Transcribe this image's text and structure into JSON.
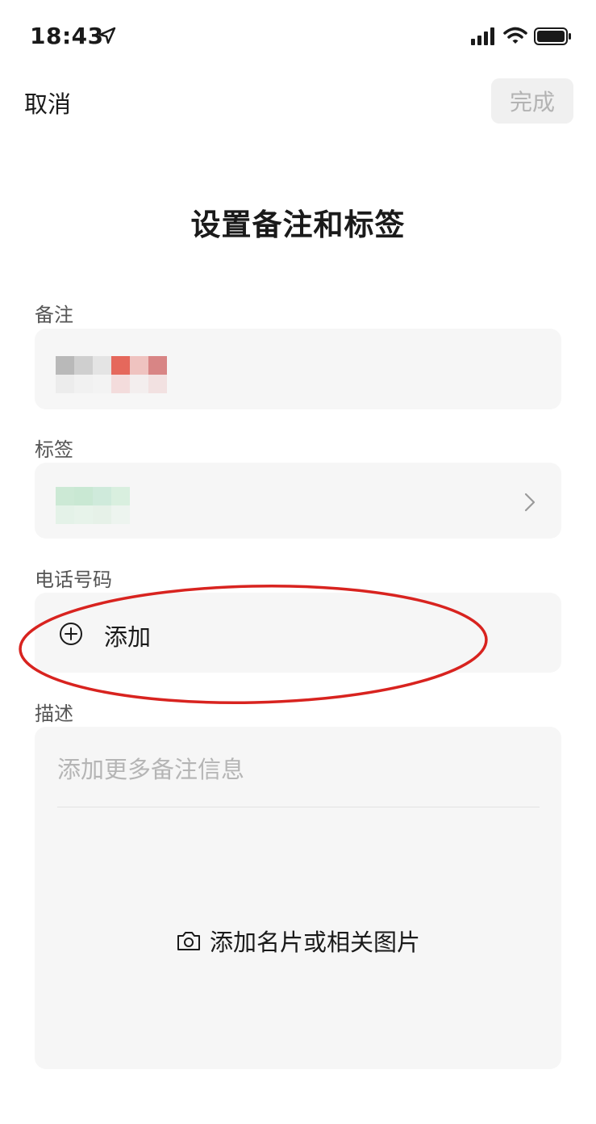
{
  "status_bar": {
    "time": "18:43",
    "icons": [
      "location-arrow-icon",
      "signal-icon",
      "wifi-icon",
      "battery-icon"
    ]
  },
  "nav": {
    "cancel_label": "取消",
    "done_label": "完成"
  },
  "page": {
    "title": "设置备注和标签"
  },
  "remark": {
    "label": "备注"
  },
  "tags": {
    "label": "标签"
  },
  "phone": {
    "label": "电话号码",
    "add_label": "添加"
  },
  "description": {
    "label": "描述",
    "placeholder": "添加更多备注信息",
    "add_photo_label": "添加名片或相关图片"
  },
  "colors": {
    "field_bg": "#f6f6f6",
    "annotation_red": "#d8231f",
    "disabled_text": "#b3b3b3"
  }
}
